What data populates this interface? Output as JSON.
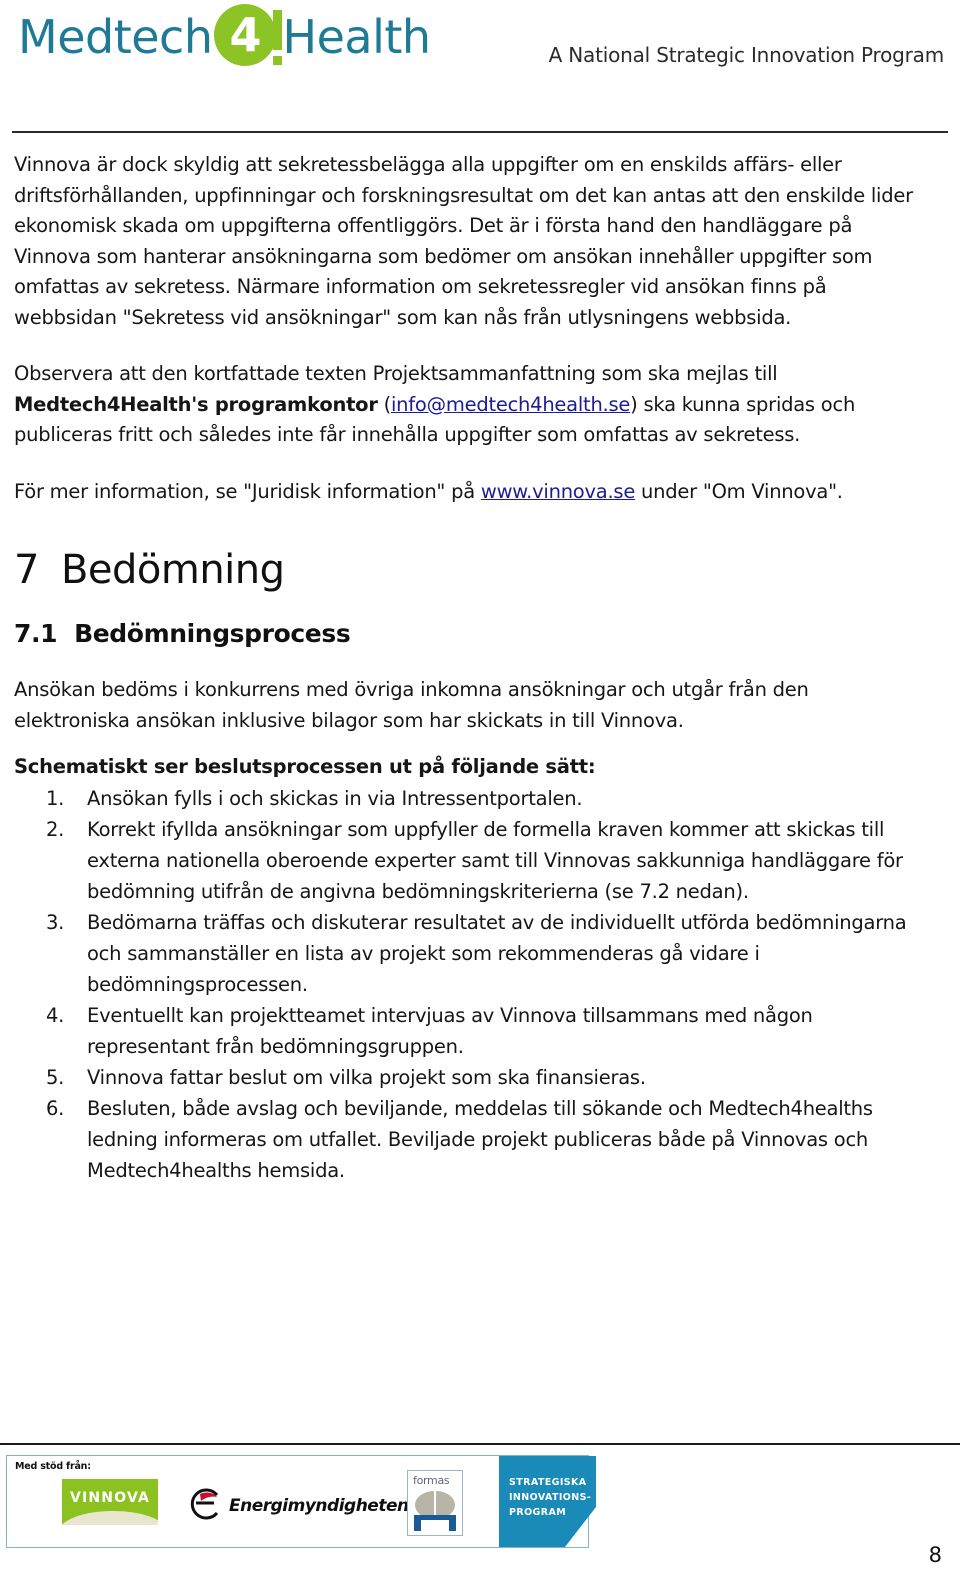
{
  "header": {
    "logo": {
      "word_left": "Medtech",
      "four": "4",
      "word_right": "Health"
    },
    "tagline": "A National Strategic Innovation Program"
  },
  "content": {
    "paragraph_1": "Vinnova är dock skyldig att sekretessbelägga alla uppgifter om en enskilds affärs- eller driftsförhållanden, uppfinningar och forskningsresultat om det kan antas att den enskilde lider ekonomisk skada om uppgifterna offentliggörs. Det är i första hand den handläggare på Vinnova som hanterar ansökningarna som bedömer om ansökan innehåller uppgifter som omfattas av sekretess. Närmare information om sekretessregler vid ansökan finns på webbsidan \"Sekretess vid ansökningar\" som kan nås från utlysningens webbsida.",
    "paragraph_2_part_1": "Observera att den kortfattade texten Projektsammanfattning som ska mejlas till ",
    "paragraph_2_bold": "Medtech4Health's programkontor",
    "paragraph_2_part_2": " (",
    "paragraph_2_link": "info@medtech4health.se",
    "paragraph_2_part_3": ") ska kunna spridas och publiceras fritt och således inte får innehålla uppgifter som omfattas av sekretess.",
    "paragraph_3_part_1": "För mer information, se \"Juridisk information\" på ",
    "paragraph_3_link": "www.vinnova.se",
    "paragraph_3_part_2": " under \"Om Vinnova\".",
    "heading_1_number": "7",
    "heading_1_text": "Bedömning",
    "heading_2_number": "7.1",
    "heading_2_text": "Bedömningsprocess",
    "paragraph_4": "Ansökan bedöms i konkurrens med övriga inkomna ansökningar och utgår från den elektroniska ansökan inklusive bilagor som har skickats in till Vinnova.",
    "list_intro": "Schematiskt ser beslutsprocessen ut på följande sätt:",
    "steps": [
      {
        "number": "1.",
        "text": "Ansökan fylls i och skickas in via Intressentportalen."
      },
      {
        "number": "2.",
        "text": "Korrekt ifyllda ansökningar som uppfyller de formella kraven kommer att skickas till externa nationella oberoende experter samt till Vinnovas sakkunniga handläggare för bedömning utifrån de angivna bedömningskriterierna (se 7.2 nedan)."
      },
      {
        "number": "3.",
        "text": "Bedömarna träffas och diskuterar resultatet av de individuellt utförda bedömningarna och sammanställer en lista av projekt som rekommenderas gå vidare i bedömningsprocessen."
      },
      {
        "number": "4.",
        "text": "Eventuellt kan projektteamet intervjuas av Vinnova tillsammans med någon representant från bedömningsgruppen."
      },
      {
        "number": "5.",
        "text": "Vinnova fattar beslut om vilka projekt som ska finansieras."
      },
      {
        "number": "6.",
        "text": "Besluten, både avslag och beviljande, meddelas till sökande och Medtech4healths ledning informeras om utfallet. Beviljade projekt publiceras både på Vinnovas och Medtech4healths hemsida."
      }
    ]
  },
  "footer": {
    "support_label": "Med stöd från:",
    "vinnova_logo_text": "VINNOVA",
    "energimyndigheten_logo_text": "Energimyndigheten",
    "formas_logo_text": "formas",
    "sip_line_1": "STRATEGISKA",
    "sip_line_2": "INNOVATIONS-",
    "sip_line_3": "PROGRAM",
    "page_number": "8"
  },
  "colors": {
    "logo_teal": "#1f7a96",
    "logo_green": "#8cc425",
    "link_blue": "#1b1b96",
    "sip_blue": "#1a8ab8",
    "vinnova_green": "#8cc220"
  }
}
